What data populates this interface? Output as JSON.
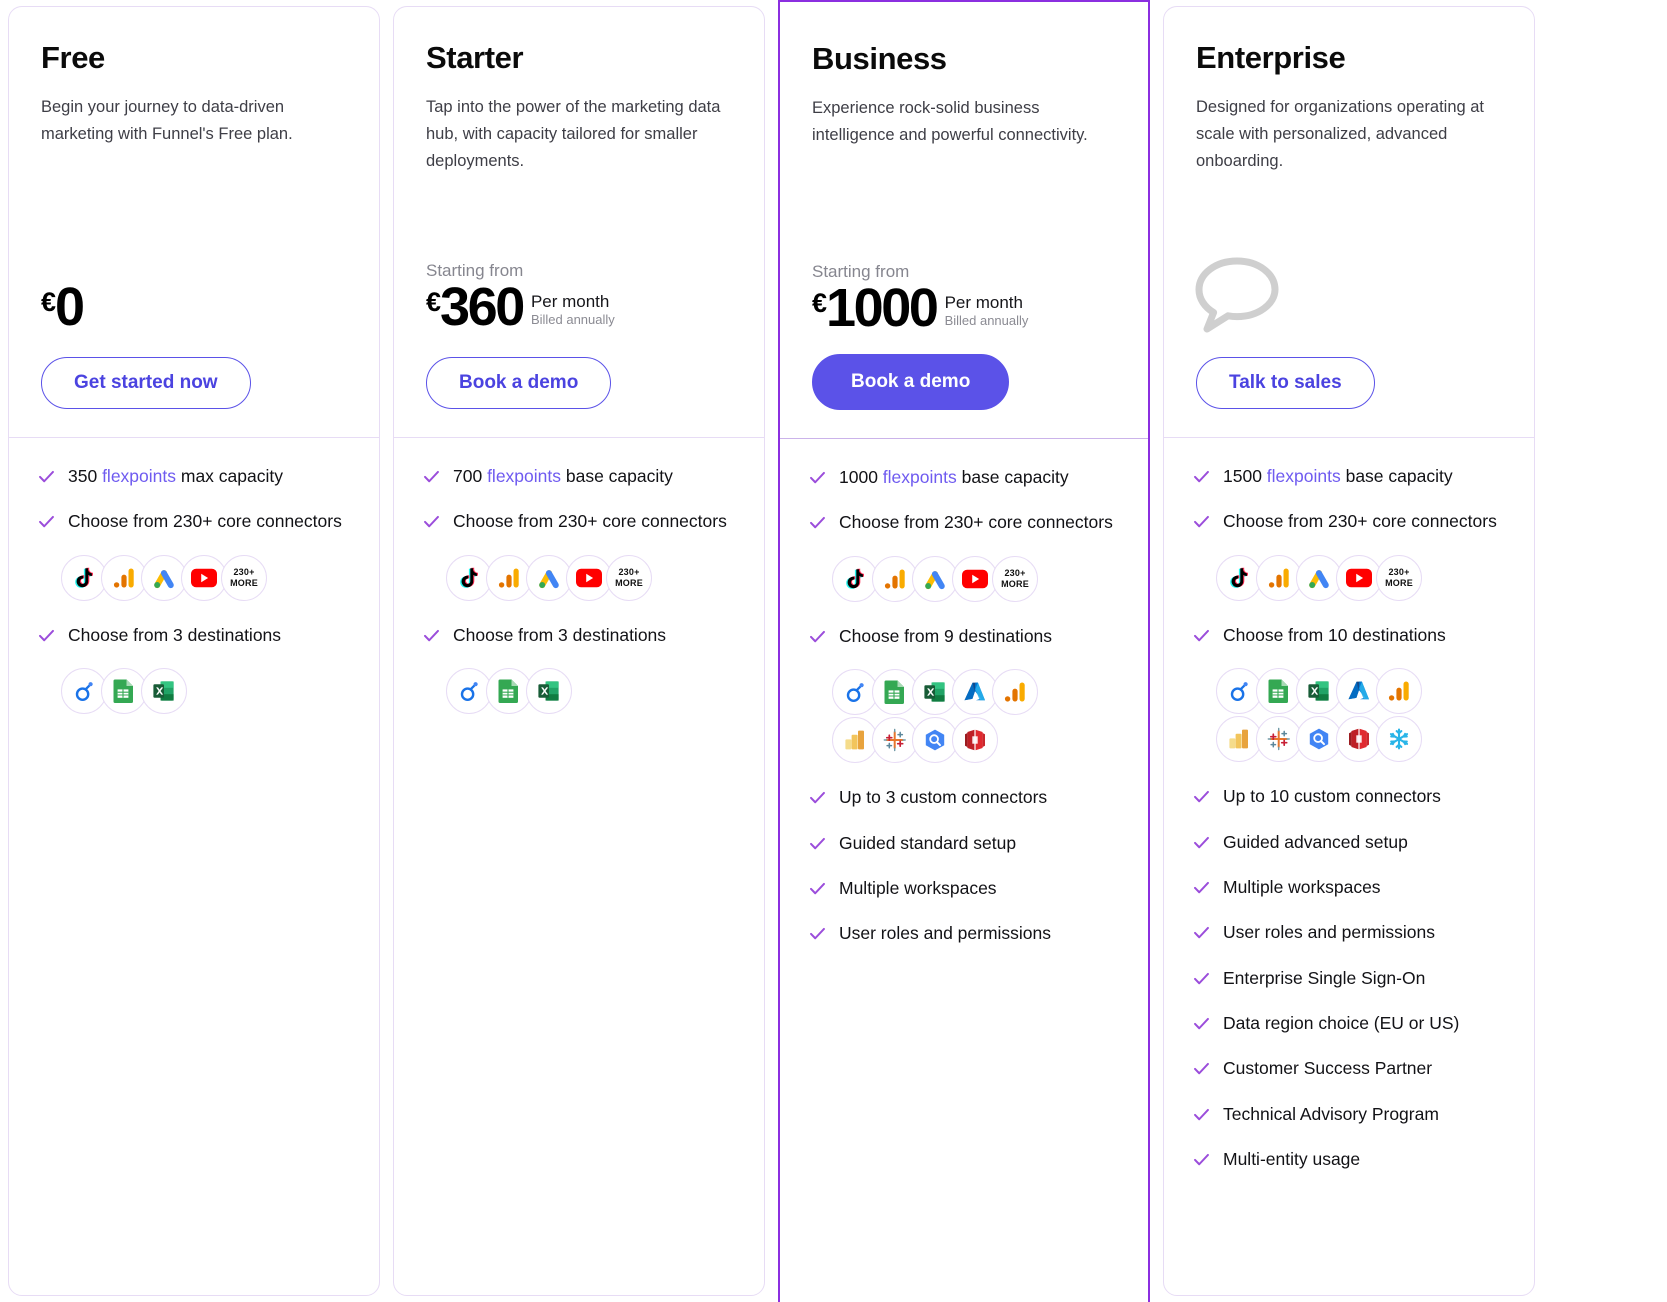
{
  "accent": {
    "purple": "#5b52e8",
    "featured_border": "#8b2fe0",
    "check": "#9b4ddb",
    "flexpoints_link": "#6f5bf0",
    "card_border": "#e7dcf5"
  },
  "labels": {
    "starting_from": "Starting from",
    "per_month": "Per month",
    "billed_annually": "Billed annually",
    "more_connectors": "230+",
    "more_word": "MORE"
  },
  "plans": [
    {
      "name": "Free",
      "description": "Begin your journey to data-driven marketing with Funnel's Free plan.",
      "has_starting_from": false,
      "currency": "€",
      "amount": "0",
      "cta": "Get started now",
      "cta_style": "outline",
      "featured": false,
      "features": [
        {
          "prefix": "350 ",
          "link": "flexpoints",
          "suffix": " max capacity"
        },
        {
          "prefix": "Choose from 230+ core connectors",
          "link": "",
          "suffix": "",
          "icons": "connectors"
        },
        {
          "prefix": "Choose from 3 destinations",
          "link": "",
          "suffix": "",
          "icons": "destinations3"
        }
      ]
    },
    {
      "name": "Starter",
      "description": "Tap into the power of the marketing data hub, with capacity tailored for smaller deployments.",
      "has_starting_from": true,
      "currency": "€",
      "amount": "360",
      "cta": "Book a demo",
      "cta_style": "outline",
      "featured": false,
      "features": [
        {
          "prefix": "700 ",
          "link": "flexpoints",
          "suffix": " base capacity"
        },
        {
          "prefix": "Choose from 230+ core connectors",
          "link": "",
          "suffix": "",
          "icons": "connectors"
        },
        {
          "prefix": "Choose from 3 destinations",
          "link": "",
          "suffix": "",
          "icons": "destinations3"
        }
      ]
    },
    {
      "name": "Business",
      "description": "Experience rock-solid business intelligence and powerful connectivity.",
      "has_starting_from": true,
      "currency": "€",
      "amount": "1000",
      "cta": "Book a demo",
      "cta_style": "primary",
      "featured": true,
      "features": [
        {
          "prefix": "1000 ",
          "link": "flexpoints",
          "suffix": " base capacity"
        },
        {
          "prefix": "Choose from 230+ core connectors",
          "link": "",
          "suffix": "",
          "icons": "connectors"
        },
        {
          "prefix": "Choose from 9 destinations",
          "link": "",
          "suffix": "",
          "icons": "destinations9"
        },
        {
          "prefix": "Up to 3 custom connectors",
          "link": "",
          "suffix": ""
        },
        {
          "prefix": "Guided standard setup",
          "link": "",
          "suffix": ""
        },
        {
          "prefix": "Multiple workspaces",
          "link": "",
          "suffix": ""
        },
        {
          "prefix": "User roles and permissions",
          "link": "",
          "suffix": ""
        }
      ]
    },
    {
      "name": "Enterprise",
      "description": "Designed for organizations operating at scale with personalized, advanced onboarding.",
      "has_starting_from": false,
      "currency": "",
      "amount": "",
      "show_bubble_icon": true,
      "cta": "Talk to sales",
      "cta_style": "outline",
      "featured": false,
      "features": [
        {
          "prefix": "1500 ",
          "link": "flexpoints",
          "suffix": " base capacity"
        },
        {
          "prefix": "Choose from 230+ core connectors",
          "link": "",
          "suffix": "",
          "icons": "connectors"
        },
        {
          "prefix": "Choose from 10 destinations",
          "link": "",
          "suffix": "",
          "icons": "destinations10"
        },
        {
          "prefix": "Up to 10 custom connectors",
          "link": "",
          "suffix": ""
        },
        {
          "prefix": "Guided advanced setup",
          "link": "",
          "suffix": ""
        },
        {
          "prefix": "Multiple workspaces",
          "link": "",
          "suffix": ""
        },
        {
          "prefix": "User roles and permissions",
          "link": "",
          "suffix": ""
        },
        {
          "prefix": "Enterprise Single Sign-On",
          "link": "",
          "suffix": ""
        },
        {
          "prefix": "Data region choice (EU or US)",
          "link": "",
          "suffix": ""
        },
        {
          "prefix": "Customer Success Partner",
          "link": "",
          "suffix": ""
        },
        {
          "prefix": "Technical Advisory Program",
          "link": "",
          "suffix": ""
        },
        {
          "prefix": "Multi-entity usage",
          "link": "",
          "suffix": ""
        }
      ]
    }
  ],
  "icon_sets": {
    "connectors": [
      "tiktok-icon",
      "google-analytics-icon",
      "google-ads-icon",
      "youtube-icon",
      "more-230-icon"
    ],
    "destinations3": [
      "looker-studio-icon",
      "google-sheets-icon",
      "excel-icon"
    ],
    "destinations9": [
      "looker-studio-icon",
      "google-sheets-icon",
      "excel-icon",
      "azure-icon",
      "google-analytics-icon",
      "power-bi-icon",
      "tableau-icon",
      "bigquery-icon",
      "redshift-icon"
    ],
    "destinations10": [
      "looker-studio-icon",
      "google-sheets-icon",
      "excel-icon",
      "azure-icon",
      "google-analytics-icon",
      "power-bi-icon",
      "tableau-icon",
      "bigquery-icon",
      "redshift-icon",
      "snowflake-icon"
    ]
  }
}
